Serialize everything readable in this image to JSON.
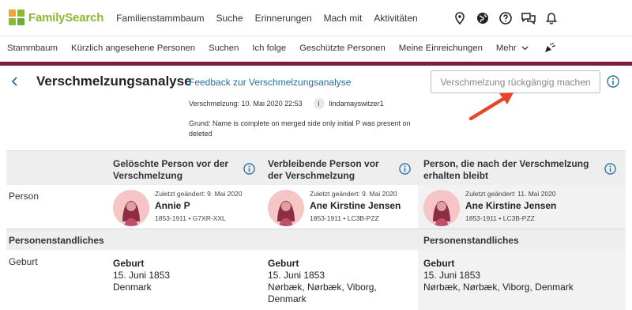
{
  "brand": {
    "name": "FamilySearch"
  },
  "main_nav": [
    "Familienstammbaum",
    "Suche",
    "Erinnerungen",
    "Mach mit",
    "Aktivitäten"
  ],
  "icons": [
    "location-pin-icon",
    "globe-icon",
    "help-icon",
    "chat-icon",
    "bell-icon"
  ],
  "sub_nav": {
    "items": [
      "Stammbaum",
      "Kürzlich angesehene Personen",
      "Suchen",
      "Ich folge",
      "Geschützte Personen",
      "Meine Einreichungen",
      "Mehr"
    ]
  },
  "header": {
    "title": "Verschmelzungsanalyse",
    "feedback": "Feedback zur Verschmelzungsanalyse",
    "merge_date": "Verschmelzung: 10. Mai 2020 22:53",
    "user_initial": "l",
    "user_name": "lindamayswitzer1",
    "reason": "Grund: Name is complete on merged side only initial P was present on deleted",
    "undo_button": "Verschmelzung rückgängig machen"
  },
  "table": {
    "columns": [
      "Gelöschte Person vor der Verschmelzung",
      "Verbleibende Person vor der Verschmelzung",
      "Person, die nach der Verschmelzung erhalten bleibt"
    ],
    "person_label": "Person",
    "persons": [
      {
        "changed": "Zuletzt geändert: 9. Mai 2020",
        "name": "Annie P",
        "meta": "1853-1911 • G7XR-XXL"
      },
      {
        "changed": "Zuletzt geändert: 9. Mai 2020",
        "name": "Ane Kirstine Jensen",
        "meta": "1853-1911 • LC3B-PZZ"
      },
      {
        "changed": "Zuletzt geändert: 11. Mai 2020",
        "name": "Ane Kirstine Jensen",
        "meta": "1853-1911 • LC3B-PZZ"
      }
    ],
    "section_title": "Personenstandliches",
    "birth_label": "Geburt",
    "births": [
      {
        "title": "Geburt",
        "date": "15. Juni 1853",
        "place": "Denmark"
      },
      {
        "title": "Geburt",
        "date": "15. Juni 1853",
        "place": "Nørbæk, Nørbæk, Viborg, Denmark"
      },
      {
        "title": "Geburt",
        "date": "15. Juni 1853",
        "place": "Nørbæk, Nørbæk, Viborg, Denmark"
      }
    ]
  },
  "colors": {
    "accent": "#7e1b3d",
    "link": "#2a6f9e",
    "arrow": "#e8462a",
    "logo_green": "#8cb832"
  }
}
